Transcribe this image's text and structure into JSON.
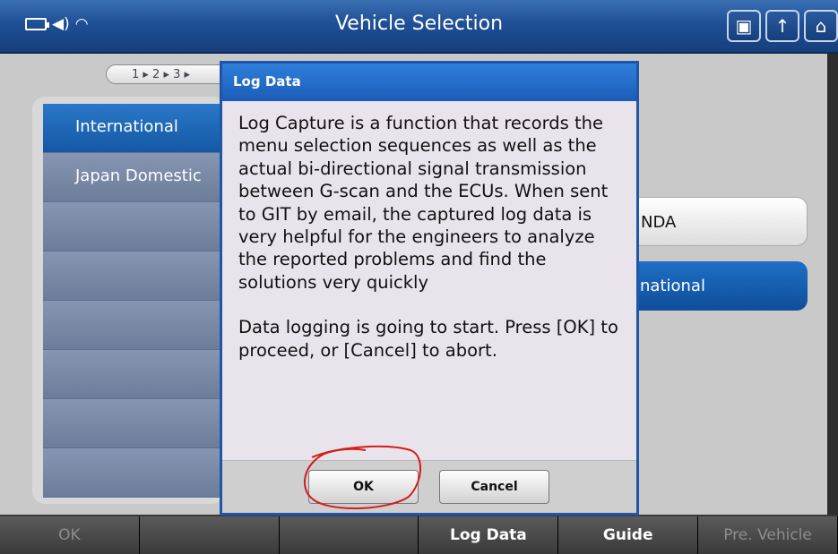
{
  "title": "Vehicle Selection",
  "breadcrumb": "1 ▸ 2 ▸ 3 ▸",
  "list": [
    {
      "label": "International"
    },
    {
      "label": "Japan Domestic"
    },
    {
      "label": ""
    },
    {
      "label": ""
    },
    {
      "label": ""
    },
    {
      "label": ""
    },
    {
      "label": ""
    },
    {
      "label": ""
    }
  ],
  "right_buttons": {
    "first": "NDA",
    "second": "national"
  },
  "dialog": {
    "title": "Log Data",
    "paragraph1": "Log Capture is a function that records the menu selection sequences as well as the actual bi-directional signal transmission between G-scan and the ECUs. When sent to GIT by email, the captured log data is very helpful for the engineers to analyze the reported problems and find the solutions very quickly",
    "paragraph2": "Data logging is going to start.  Press [OK] to proceed, or [Cancel] to abort.",
    "ok_label": "OK",
    "cancel_label": "Cancel"
  },
  "toolbar": {
    "b1": "OK",
    "b2": "",
    "b3": "",
    "b4": "Log Data",
    "b5": "Guide",
    "b6": "Pre. Vehicle"
  },
  "colors": {
    "title_bar": "#1f4f95",
    "selected": "#1458a4",
    "annotation": "#d41c1c"
  }
}
